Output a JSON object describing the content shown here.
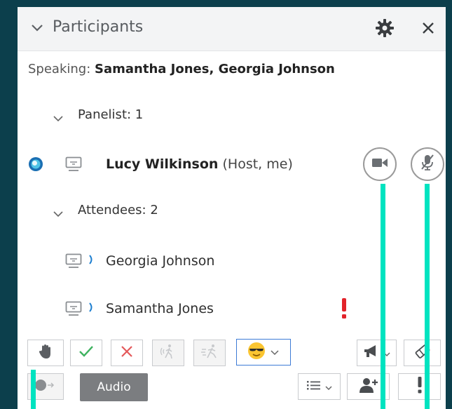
{
  "header": {
    "title": "Participants"
  },
  "speaking": {
    "prefix": "Speaking: ",
    "names": "Samantha Jones, Georgia Johnson"
  },
  "panelists": {
    "label": "Panelist: 1",
    "items": [
      {
        "name": "Lucy Wilkinson",
        "role": "(Host, me)"
      }
    ]
  },
  "attendees": {
    "label": "Attendees: 2",
    "items": [
      {
        "name": "Georgia Johnson"
      },
      {
        "name": "Samantha Jones"
      }
    ]
  },
  "toolbar": {
    "audio_label": "Audio"
  },
  "colors": {
    "background": "#0c3f4c",
    "accent_teal": "#00e3c0",
    "alert_red": "#e2232a",
    "check_green": "#3eb25f",
    "x_red": "#e4585a",
    "emoji_blue": "#1a67c9"
  },
  "icons": [
    "chevron-down-icon",
    "gear-icon",
    "close-icon",
    "screen-share-icon",
    "audio-wave-icon",
    "video-camera-icon",
    "mic-muted-icon",
    "raise-hand-icon",
    "check-icon",
    "x-icon",
    "go-slower-icon",
    "go-faster-icon",
    "emoji-icon",
    "megaphone-icon",
    "eraser-icon",
    "audio-connect-icon",
    "list-icon",
    "add-person-icon",
    "alert-icon"
  ]
}
